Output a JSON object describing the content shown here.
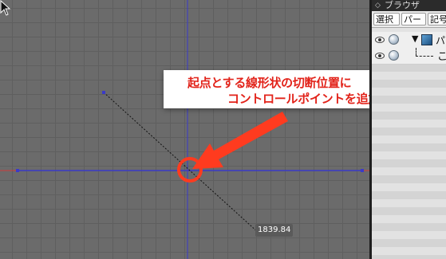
{
  "viewport": {
    "measurement": "1839.84"
  },
  "callout": {
    "line1": "起点とする線形状の切断位置に",
    "line2": "コントロールポイントを追加",
    "color": "#e2231a"
  },
  "browser": {
    "title": "ブラウザ",
    "tabs": [
      "選択",
      "パー",
      "記号"
    ],
    "rows": [
      {
        "label": "パ"
      },
      {
        "label": "こ"
      }
    ]
  },
  "colors": {
    "axis_blue": "#3a3ac8",
    "axis_red": "#cc3b3b",
    "highlight_red": "#ff3b1f",
    "viewport_bg": "#6b6b6b"
  }
}
